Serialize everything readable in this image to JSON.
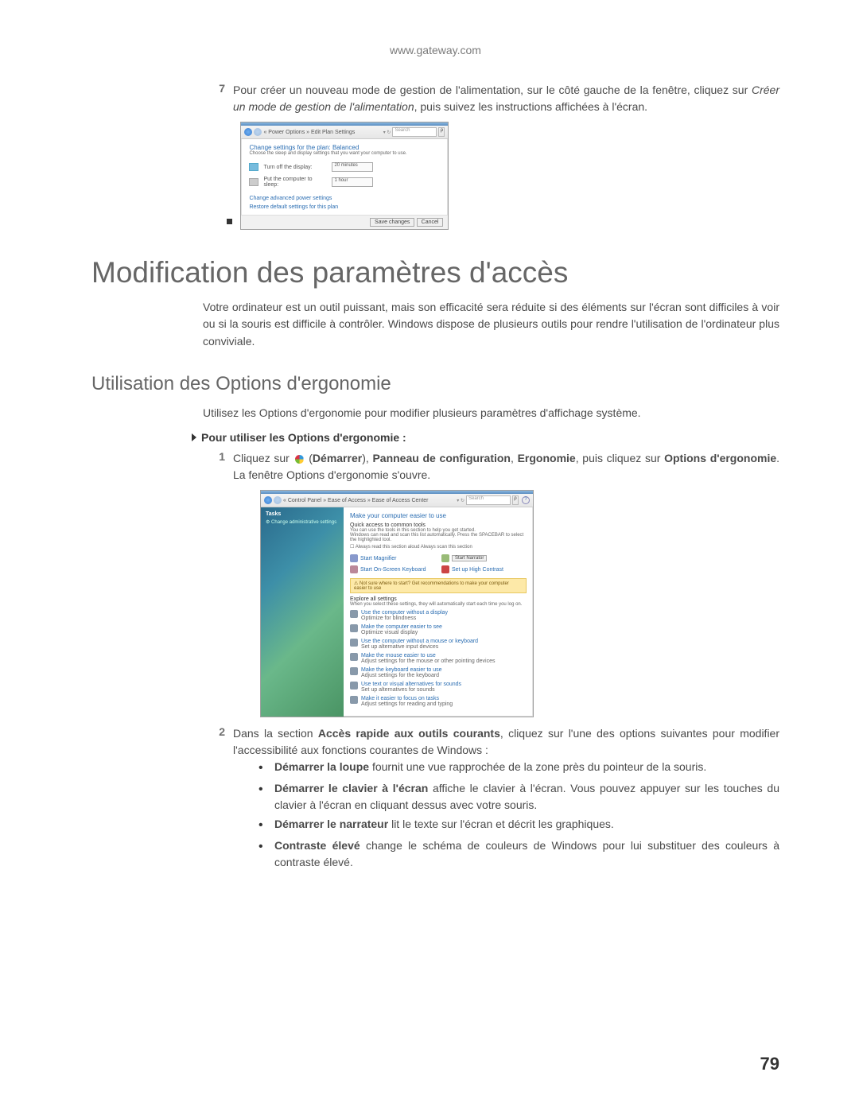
{
  "header_url": "www.gateway.com",
  "step7": {
    "num": "7",
    "text_before_italic": "Pour créer un nouveau mode de gestion de l'alimentation, sur le côté gauche de la fenêtre, cliquez sur ",
    "italic": "Créer un mode de gestion de l'alimentation",
    "text_after_italic": ", puis suivez les instructions affichées à l'écran."
  },
  "win1": {
    "path": "« Power Options » Edit Plan Settings",
    "search": "Search",
    "heading": "Change settings for the plan: Balanced",
    "sub": "Choose the sleep and display settings that you want your computer to use.",
    "row1_label": "Turn off the display:",
    "row1_val": "20 minutes",
    "row2_label": "Put the computer to sleep:",
    "row2_val": "1 hour",
    "link1": "Change advanced power settings",
    "link2": "Restore default settings for this plan",
    "btn_save": "Save changes",
    "btn_cancel": "Cancel"
  },
  "h1": "Modification des paramètres d'accès",
  "intro_para": "Votre ordinateur est un outil puissant, mais son efficacité sera réduite si des éléments sur l'écran sont difficiles à voir ou si la souris est difficile à contrôler. Windows dispose de plusieurs outils pour rendre l'utilisation de l'ordinateur plus conviviale.",
  "h2": "Utilisation des Options d'ergonomie",
  "h2_para": "Utilisez les Options d'ergonomie pour modifier plusieurs paramètres d'affichage système.",
  "subhead": "Pour utiliser les Options d'ergonomie :",
  "step1": {
    "num": "1",
    "pre": "Cliquez sur ",
    "demarrer": "Démarrer",
    "sep1": ", ",
    "panneau": "Panneau de configuration",
    "sep2": ", ",
    "ergo": "Ergonomie",
    "mid": ", puis cliquez sur ",
    "options": "Options d'ergonomie",
    "post": ". La fenêtre Options d'ergonomie s'ouvre."
  },
  "win2": {
    "path": "« Control Panel » Ease of Access » Ease of Access Center",
    "tasks": "Tasks",
    "side_link": "Change administrative settings",
    "heading": "Make your computer easier to use",
    "quick": "Quick access to common tools",
    "quick_sub1": "You can use the tools in this section to help you get started.",
    "quick_sub2": "Windows can read and scan this list automatically. Press the SPACEBAR to select the highlighted tool.",
    "chk": "Always read this section aloud    Always scan this section",
    "tool1": "Start Magnifier",
    "tool2": "Start Narrator",
    "tool3": "Start On-Screen Keyboard",
    "tool4": "Set up High Contrast",
    "yellow": "Not sure where to start? Get recommendations to make your computer easier to use",
    "explore": "Explore all settings",
    "explore_sub": "When you select these settings, they will automatically start each time you log on.",
    "e1a": "Use the computer without a display",
    "e1b": "Optimize for blindness",
    "e2a": "Make the computer easier to see",
    "e2b": "Optimize visual display",
    "e3a": "Use the computer without a mouse or keyboard",
    "e3b": "Set up alternative input devices",
    "e4a": "Make the mouse easier to use",
    "e4b": "Adjust settings for the mouse or other pointing devices",
    "e5a": "Make the keyboard easier to use",
    "e5b": "Adjust settings for the keyboard",
    "e6a": "Use text or visual alternatives for sounds",
    "e6b": "Set up alternatives for sounds",
    "e7a": "Make it easier to focus on tasks",
    "e7b": "Adjust settings for reading and typing"
  },
  "step2": {
    "num": "2",
    "pre": "Dans la section ",
    "bold": "Accès rapide aux outils courants",
    "post": ", cliquez sur l'une des options suivantes pour modifier l'accessibilité aux fonctions courantes de Windows :"
  },
  "bullets": [
    {
      "b": "Démarrer la loupe",
      "t": " fournit une vue rapprochée de la zone près du pointeur de la souris."
    },
    {
      "b": "Démarrer le clavier à l'écran",
      "t": " affiche le clavier à l'écran. Vous pouvez appuyer sur les touches du clavier à l'écran en cliquant dessus avec votre souris."
    },
    {
      "b": "Démarrer le narrateur",
      "t": " lit le texte sur l'écran et décrit les graphiques."
    },
    {
      "b": "Contraste élevé",
      "t": " change le schéma de couleurs de Windows pour lui substituer des couleurs à contraste élevé."
    }
  ],
  "page_num": "79"
}
